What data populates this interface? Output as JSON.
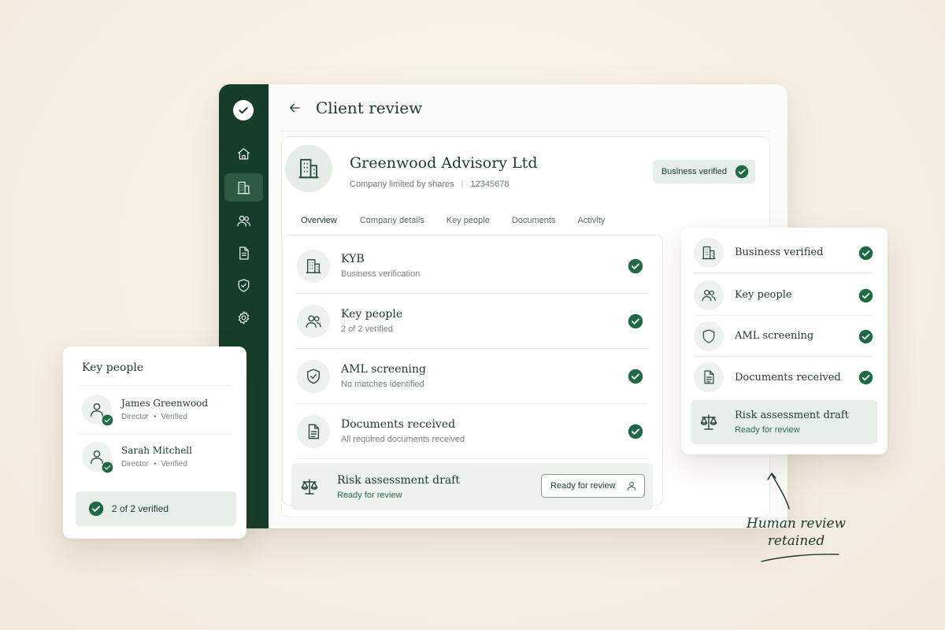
{
  "page": {
    "title": "Client review"
  },
  "company": {
    "name": "Greenwood Advisory Ltd",
    "type": "Company limited by shares",
    "number": "12345678",
    "badge": "Business verified"
  },
  "tabs": [
    "Overview",
    "Company details",
    "Key people",
    "Documents",
    "Activity"
  ],
  "checks": [
    {
      "title": "KYB",
      "subtitle": "Business verification",
      "icon": "building-icon"
    },
    {
      "title": "Key people",
      "subtitle": "2 of 2 verified",
      "icon": "people-icon"
    },
    {
      "title": "AML screening",
      "subtitle": "No matches identified",
      "icon": "shield-check-icon"
    },
    {
      "title": "Documents received",
      "subtitle": "All required documents received",
      "icon": "document-icon"
    },
    {
      "title": "Risk assessment draft",
      "subtitle": "Ready for review",
      "icon": "scales-icon",
      "button": "Ready for review"
    }
  ],
  "key_people_card": {
    "title": "Key people",
    "people": [
      {
        "name": "James Greenwood",
        "role": "Director",
        "status": "Verified"
      },
      {
        "name": "Sarah Mitchell",
        "role": "Director",
        "status": "Verified"
      }
    ],
    "summary": "2 of 2 verified"
  },
  "status_card": {
    "items": [
      {
        "label": "Business verified",
        "icon": "building-icon"
      },
      {
        "label": "Key people",
        "icon": "people-icon"
      },
      {
        "label": "AML screening",
        "icon": "shield-icon"
      },
      {
        "label": "Documents received",
        "icon": "document-icon"
      },
      {
        "label": "Risk assessment draft",
        "subtitle": "Ready for review",
        "icon": "scales-icon"
      }
    ]
  },
  "annotation": {
    "line1": "Human review",
    "line2": "retained"
  },
  "colors": {
    "brand": "#153d2a",
    "accent": "#1f6b45",
    "surface": "#e8efe9"
  }
}
